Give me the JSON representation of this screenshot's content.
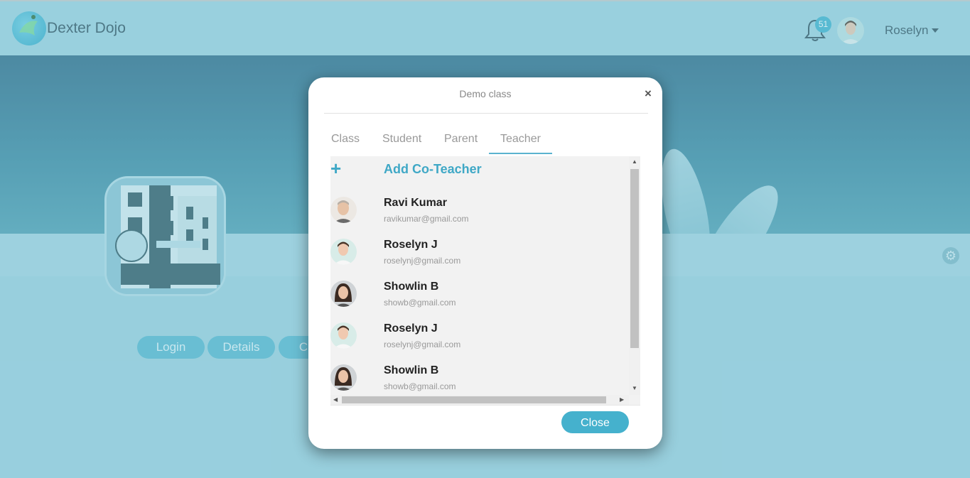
{
  "app": {
    "name": "Dexter Dojo",
    "notification_count": "51",
    "user_name": "Roselyn"
  },
  "profile": {
    "buttons": [
      "Login",
      "Details",
      "C"
    ]
  },
  "modal": {
    "title": "Demo class",
    "close_x": "×",
    "tabs": [
      "Class",
      "Student",
      "Parent",
      "Teacher"
    ],
    "active_tab": "Teacher",
    "add_icon": "+",
    "add_label": "Add Co-Teacher",
    "teachers": [
      {
        "name": "Ravi Kumar",
        "email": "ravikumar@gmail.com"
      },
      {
        "name": "Roselyn J",
        "email": "roselynj@gmail.com"
      },
      {
        "name": "Showlin B",
        "email": "showb@gmail.com"
      },
      {
        "name": "Roselyn J",
        "email": "roselynj@gmail.com"
      },
      {
        "name": "Showlin B",
        "email": "showb@gmail.com"
      }
    ],
    "close_button": "Close"
  },
  "colors": {
    "accent": "#45b1cd",
    "nav_bg": "#a0d4e2",
    "banner": "#2b6886"
  },
  "icons": {
    "bell": "bell-icon",
    "settings": "gear-icon",
    "plus": "plus-icon",
    "close": "close-icon"
  }
}
